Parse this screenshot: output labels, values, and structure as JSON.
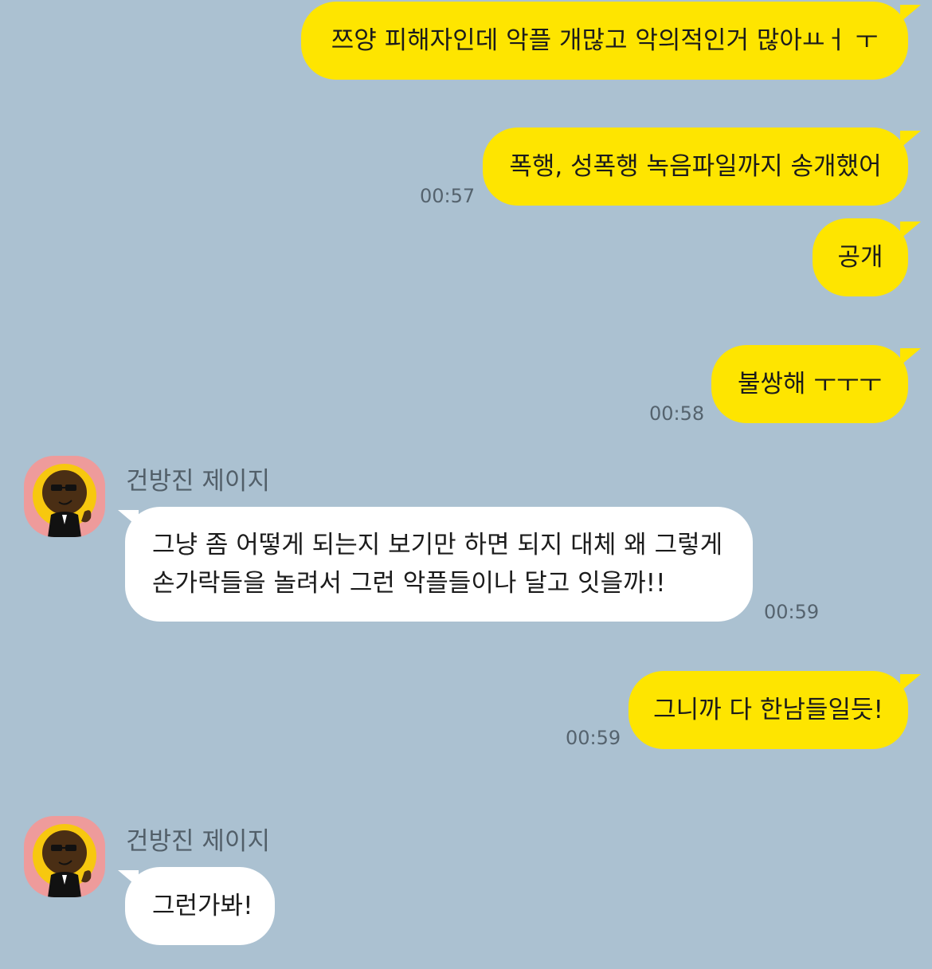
{
  "colors": {
    "background": "#abc1d1",
    "my_bubble": "#fee500",
    "their_bubble": "#ffffff",
    "avatar_bg": "#ee9b9b"
  },
  "messages": [
    {
      "from": "me",
      "text": "쯔양 피해자인데 악플 개많고 악의적인거 많아ㅛㅓ ㅜ",
      "time": ""
    },
    {
      "from": "me",
      "text": "폭행, 성폭행 녹음파일까지 송개했어",
      "time": "00:57"
    },
    {
      "from": "me",
      "text": "공개",
      "time": ""
    },
    {
      "from": "me",
      "text": "불쌍해 ㅜㅜㅜ",
      "time": "00:58"
    },
    {
      "from": "them",
      "sender": "건방진 제이지",
      "lines": [
        "그냥 좀 어떻게 되는지 보기만 하면 되지 대체 왜 그렇게",
        "손가락들을 놀려서 그런 악플들이나 달고 잇을까!!"
      ],
      "time": "00:59",
      "avatar_icon": "jay-g-character-icon"
    },
    {
      "from": "me",
      "text": "그니까 다 한남들일듯!",
      "time": "00:59"
    },
    {
      "from": "them",
      "sender": "건방진 제이지",
      "lines": [
        "그런가봐!"
      ],
      "time": "",
      "avatar_icon": "jay-g-character-icon"
    }
  ]
}
